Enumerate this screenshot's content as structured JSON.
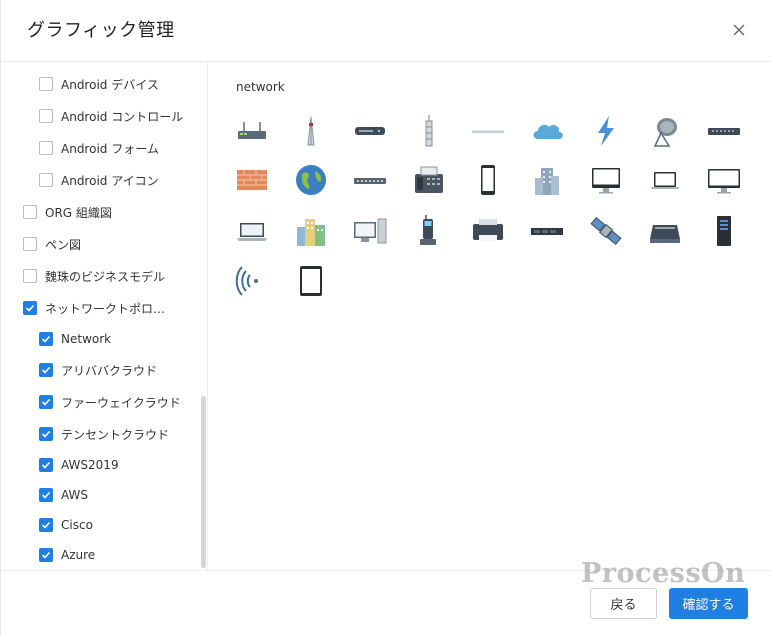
{
  "dialog": {
    "title": "グラフィック管理",
    "close_icon": "close-icon"
  },
  "sidebar": {
    "items": [
      {
        "label": "Android デバイス",
        "checked": false
      },
      {
        "label": "Android コントロール",
        "checked": false
      },
      {
        "label": "Android フォーム",
        "checked": false
      },
      {
        "label": "Android アイコン",
        "checked": false
      },
      {
        "label": "ORG 組織図",
        "checked": false
      },
      {
        "label": "ペン図",
        "checked": false
      },
      {
        "label": "魏珠のビジネスモデル",
        "checked": false
      },
      {
        "label": "ネットワークトポロ…",
        "checked": true
      },
      {
        "label": "Network",
        "checked": true
      },
      {
        "label": "アリババクラウド",
        "checked": true
      },
      {
        "label": "ファーウェイクラウド",
        "checked": true
      },
      {
        "label": "テンセントクラウド",
        "checked": true
      },
      {
        "label": "AWS2019",
        "checked": true
      },
      {
        "label": "AWS",
        "checked": true
      },
      {
        "label": "Cisco",
        "checked": true
      },
      {
        "label": "Azure",
        "checked": true
      }
    ]
  },
  "main": {
    "section_title": "network",
    "icons": [
      "router-icon",
      "antenna-tower-icon",
      "modem-icon",
      "cell-tower-icon",
      "cable-icon",
      "cloud-icon",
      "lightning-icon",
      "satellite-dish-icon",
      "switch-icon",
      "firewall-icon",
      "globe-icon",
      "hub-icon",
      "fax-icon",
      "smartphone-icon",
      "building-icon",
      "monitor-icon",
      "laptop-icon",
      "wide-monitor-icon",
      "notebook-icon",
      "city-buildings-icon",
      "desktop-computer-icon",
      "cordless-phone-icon",
      "printer-icon",
      "rack-server-icon",
      "satellite-icon",
      "scanner-icon",
      "tower-server-icon",
      "wireless-signal-icon",
      "tablet-icon"
    ]
  },
  "footer": {
    "back_label": "戻る",
    "ok_label": "確認する"
  },
  "watermark": "ProcessOn",
  "colors": {
    "accent": "#1f7fe3",
    "checkbox_border": "#b9b9b9"
  }
}
